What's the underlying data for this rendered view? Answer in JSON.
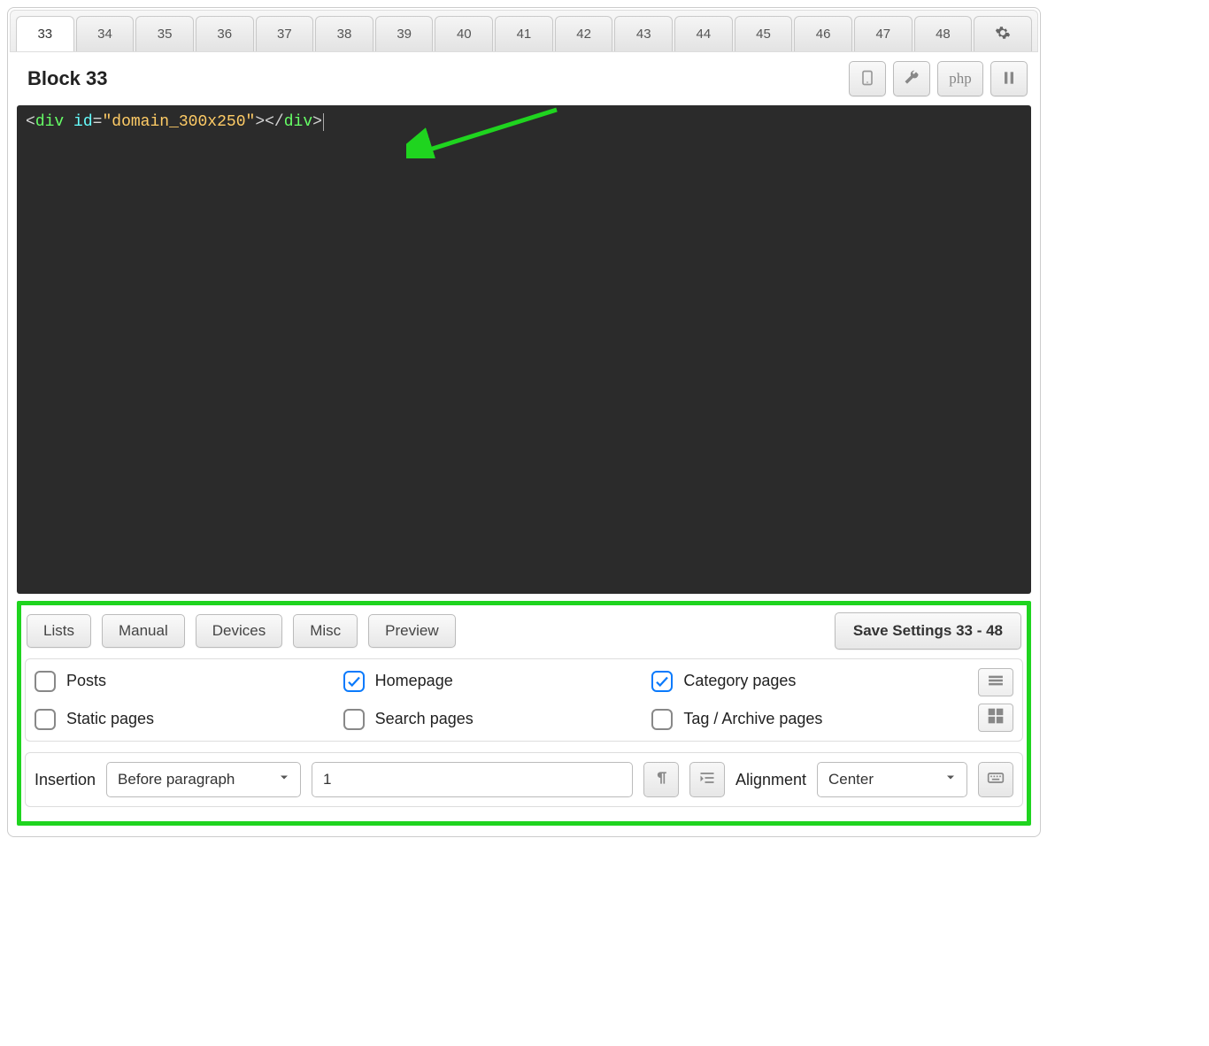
{
  "tabs": {
    "items": [
      "33",
      "34",
      "35",
      "36",
      "37",
      "38",
      "39",
      "40",
      "41",
      "42",
      "43",
      "44",
      "45",
      "46",
      "47",
      "48"
    ],
    "active": "33"
  },
  "header": {
    "title": "Block 33",
    "tools": {
      "php_label": "php"
    }
  },
  "code": {
    "tokens": {
      "lt1": "<",
      "tag1": "div",
      "sp1": " ",
      "attr": "id",
      "eq": "=",
      "q1": "\"",
      "val": "domain_300x250",
      "q2": "\"",
      "gt1": ">",
      "lt2": "</",
      "tag2": "div",
      "gt2": ">"
    }
  },
  "actions": {
    "lists": "Lists",
    "manual": "Manual",
    "devices": "Devices",
    "misc": "Misc",
    "preview": "Preview",
    "save": "Save Settings 33 - 48"
  },
  "page_types": {
    "posts": {
      "label": "Posts",
      "checked": false
    },
    "homepage": {
      "label": "Homepage",
      "checked": true
    },
    "category": {
      "label": "Category pages",
      "checked": true
    },
    "static": {
      "label": "Static pages",
      "checked": false
    },
    "search": {
      "label": "Search pages",
      "checked": false
    },
    "tag_archive": {
      "label": "Tag / Archive pages",
      "checked": false
    }
  },
  "insertion": {
    "label": "Insertion",
    "position": "Before paragraph",
    "value": "1",
    "alignment_label": "Alignment",
    "alignment": "Center"
  }
}
